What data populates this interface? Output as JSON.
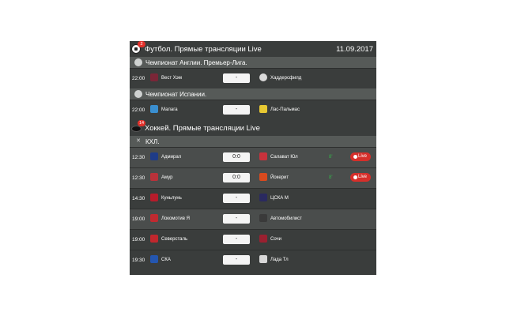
{
  "football": {
    "title": "Футбол. Прямые трансляции Live",
    "date": "11.09.2017",
    "badge": "2",
    "leagues": [
      {
        "name": "Чемпионат Англии. Премьер-Лига.",
        "matches": [
          {
            "time": "22:00",
            "home": "Вест Хэм",
            "score": "-",
            "away": "Хаддерсфилд",
            "home_color": "#7a2637",
            "away_color": "#d9d9d9"
          }
        ]
      },
      {
        "name": "Чемпионат Испании.",
        "matches": [
          {
            "time": "22:00",
            "home": "Малага",
            "score": "-",
            "away": "Лас-Пальмас",
            "home_color": "#3a8fd0",
            "away_color": "#e7c832"
          }
        ]
      }
    ]
  },
  "hockey": {
    "title": "Хоккей. Прямые трансляции Live",
    "badge": "14",
    "leagues": [
      {
        "name": "КХЛ.",
        "matches": [
          {
            "time": "12:30",
            "home": "Адмирал",
            "score": "0:0",
            "away": "Салават Юл",
            "minute": "8'",
            "live": "Live",
            "home_color": "#1f3c88",
            "away_color": "#c8323c"
          },
          {
            "time": "12:30",
            "home": "Амур",
            "score": "0:0",
            "away": "Йокерит",
            "minute": "8'",
            "live": "Live",
            "home_color": "#b8323a",
            "away_color": "#d94a1e"
          },
          {
            "time": "14:30",
            "home": "Куньлунь",
            "score": "-",
            "away": "ЦСКА М",
            "home_color": "#b71c2b",
            "away_color": "#2a2a60"
          },
          {
            "time": "19:00",
            "home": "Локомотив Я",
            "score": "-",
            "away": "Автомобилист",
            "home_color": "#c02a30",
            "away_color": "#3a3a3a"
          },
          {
            "time": "19:00",
            "home": "Северсталь",
            "score": "-",
            "away": "Сочи",
            "home_color": "#c0272d",
            "away_color": "#9a2030"
          },
          {
            "time": "19:30",
            "home": "СКА",
            "score": "-",
            "away": "Лада Тл",
            "home_color": "#2456b0",
            "away_color": "#d8d8d8"
          }
        ]
      }
    ]
  }
}
